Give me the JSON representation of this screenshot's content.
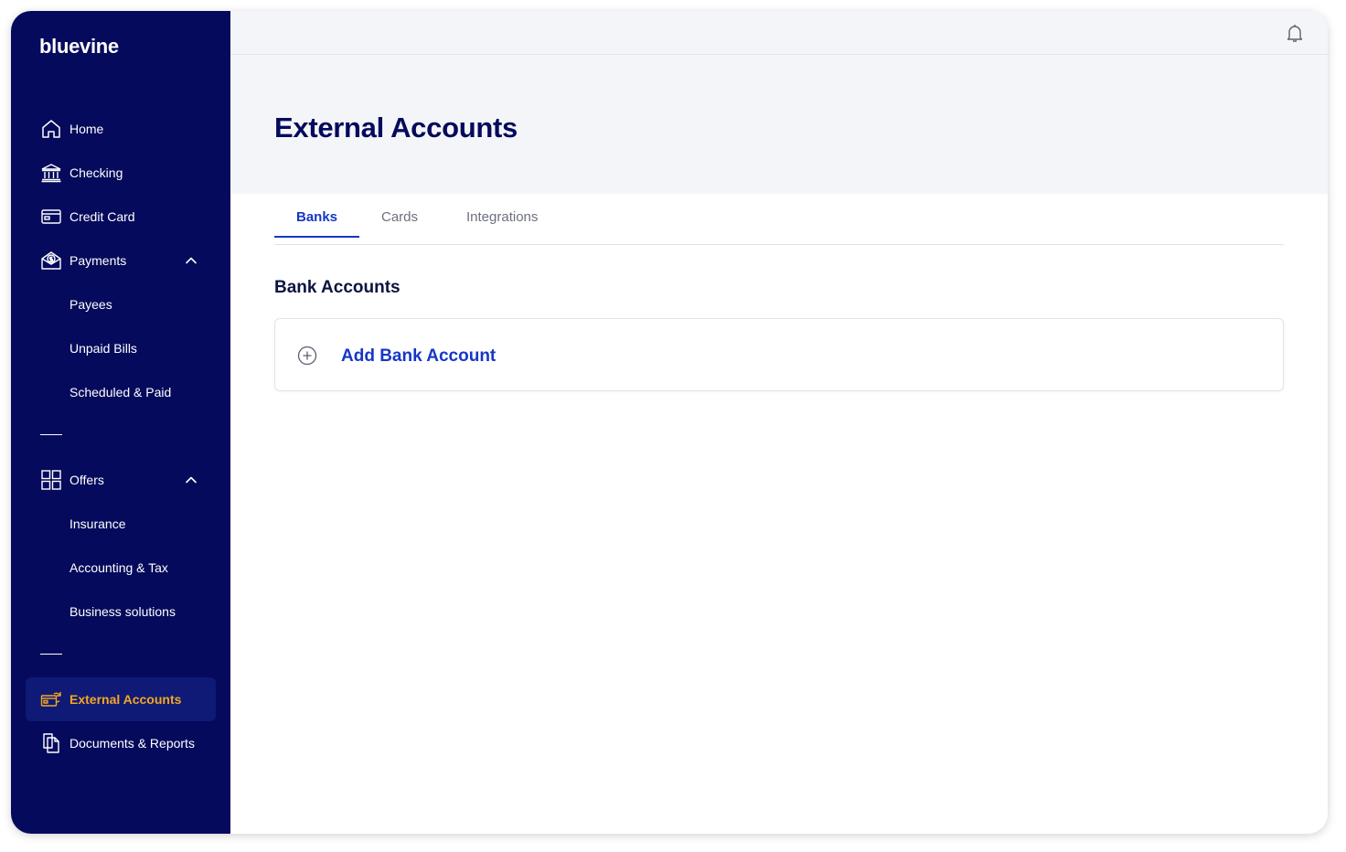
{
  "brand": {
    "logo": "bluevine"
  },
  "sidebar": {
    "items": [
      {
        "key": "home",
        "label": "Home",
        "icon": "home-icon"
      },
      {
        "key": "checking",
        "label": "Checking",
        "icon": "bank-icon"
      },
      {
        "key": "credit-card",
        "label": "Credit Card",
        "icon": "credit-card-icon"
      },
      {
        "key": "payments",
        "label": "Payments",
        "icon": "payments-icon",
        "expanded": true
      },
      {
        "key": "payees",
        "label": "Payees"
      },
      {
        "key": "unpaid-bills",
        "label": "Unpaid Bills"
      },
      {
        "key": "scheduled-paid",
        "label": "Scheduled & Paid"
      },
      {
        "key": "offers",
        "label": "Offers",
        "icon": "grid-icon",
        "expanded": true
      },
      {
        "key": "insurance",
        "label": "Insurance"
      },
      {
        "key": "accounting-tax",
        "label": "Accounting & Tax"
      },
      {
        "key": "business-solutions",
        "label": "Business solutions"
      },
      {
        "key": "external-accounts",
        "label": "External Accounts",
        "icon": "external-accounts-icon",
        "active": true
      },
      {
        "key": "documents-reports",
        "label": "Documents & Reports",
        "icon": "documents-icon"
      }
    ]
  },
  "header": {
    "notification_icon": "bell-icon"
  },
  "page": {
    "title": "External Accounts",
    "tabs": [
      {
        "label": "Banks",
        "active": true
      },
      {
        "label": "Cards",
        "active": false
      },
      {
        "label": "Integrations",
        "active": false
      }
    ],
    "section_title": "Bank Accounts",
    "add_bank_account_label": "Add Bank Account"
  },
  "colors": {
    "sidebar_bg": "#050a5c",
    "active_item_text": "#f5a623",
    "accent_blue": "#1637c6",
    "title_navy": "#050a5c",
    "header_bg": "#f4f5f8"
  }
}
